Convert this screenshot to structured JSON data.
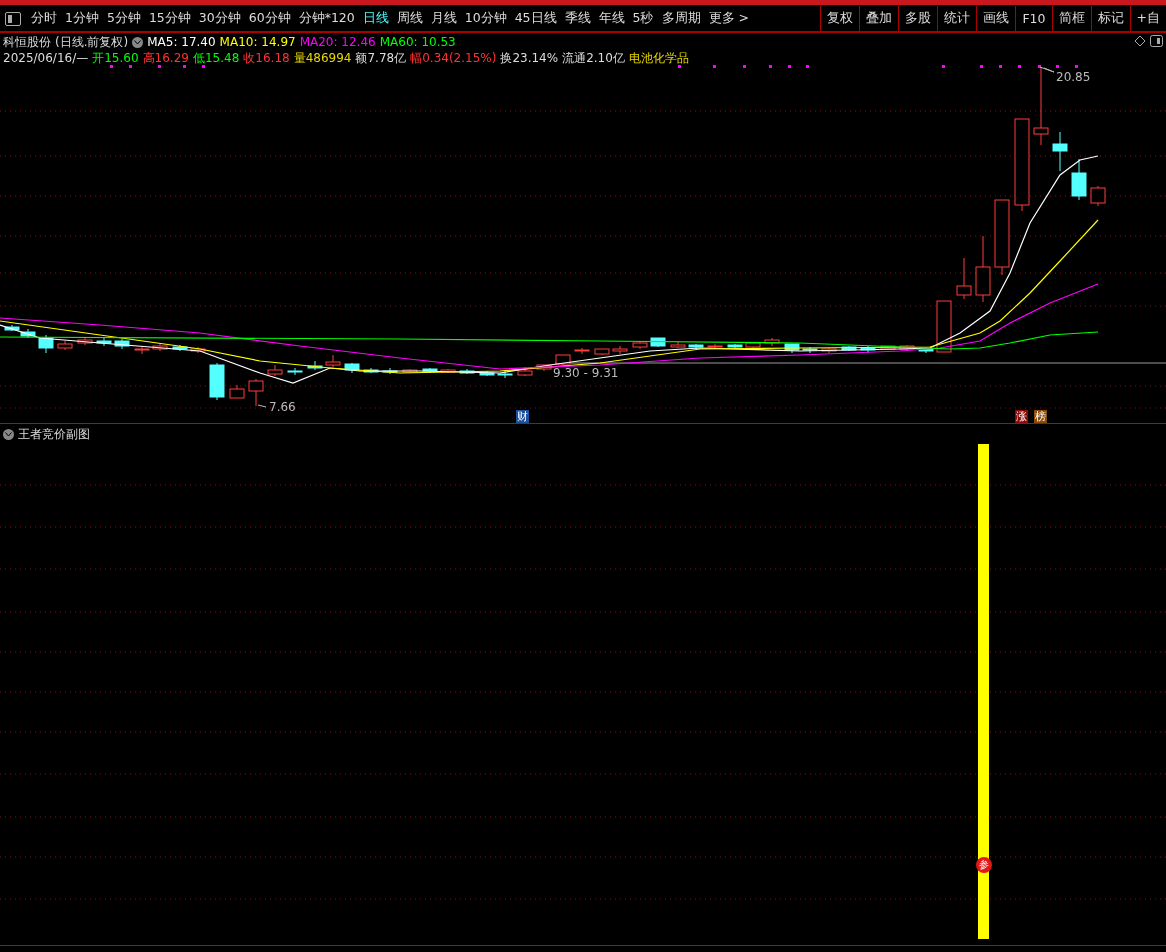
{
  "toolbar": {
    "periods": [
      {
        "label": "分时",
        "selected": false
      },
      {
        "label": "1分钟",
        "selected": false
      },
      {
        "label": "5分钟",
        "selected": false
      },
      {
        "label": "15分钟",
        "selected": false
      },
      {
        "label": "30分钟",
        "selected": false
      },
      {
        "label": "60分钟",
        "selected": false
      },
      {
        "label": "分钟*120",
        "selected": false
      },
      {
        "label": "日线",
        "selected": true
      },
      {
        "label": "周线",
        "selected": false
      },
      {
        "label": "月线",
        "selected": false
      },
      {
        "label": "10分钟",
        "selected": false
      },
      {
        "label": "45日线",
        "selected": false
      },
      {
        "label": "季线",
        "selected": false
      },
      {
        "label": "年线",
        "selected": false
      },
      {
        "label": "5秒",
        "selected": false
      },
      {
        "label": "多周期",
        "selected": false
      },
      {
        "label": "更多 >",
        "selected": false
      }
    ],
    "tools": [
      "复权",
      "叠加",
      "多股",
      "统计",
      "画线",
      "F10",
      "简框",
      "标记",
      "+自"
    ]
  },
  "stock": {
    "name": "科恒股份",
    "mode": "(日线.前复权)",
    "ma": [
      {
        "label": "MA5: 17.40",
        "color": "#ffffff"
      },
      {
        "label": "MA10: 14.97",
        "color": "#ffff00"
      },
      {
        "label": "MA20: 12.46",
        "color": "#ff00ff"
      },
      {
        "label": "MA60: 10.53",
        "color": "#00ff00"
      }
    ]
  },
  "quote": {
    "date": "2025/06/16/—",
    "items": [
      {
        "text": "开15.60",
        "color": "#00ff00"
      },
      {
        "text": "高16.29",
        "color": "#ff3232"
      },
      {
        "text": "低15.48",
        "color": "#00ff00"
      },
      {
        "text": "收16.18",
        "color": "#ff3232"
      },
      {
        "text": "量486994",
        "color": "#e8d800"
      },
      {
        "text": "额7.78亿",
        "color": "#dddddd"
      },
      {
        "text": "幅0.34(2.15%)",
        "color": "#ff3232"
      },
      {
        "text": "换23.14%",
        "color": "#dddddd"
      },
      {
        "text": "流通2.10亿",
        "color": "#dddddd"
      },
      {
        "text": "电池化学品",
        "color": "#e8d800"
      }
    ]
  },
  "chart": {
    "high_label": "20.85",
    "low_label": "7.66",
    "range_label": "9.30 - 9.31",
    "markers": [
      {
        "text": "财",
        "color": "#1c4f9c"
      },
      {
        "text": "涨",
        "color": "#8b0a0a"
      },
      {
        "text": "榜",
        "color": "#8a4a0a"
      }
    ]
  },
  "subchart": {
    "title": "王者竞价副图",
    "badge": "参"
  }
}
